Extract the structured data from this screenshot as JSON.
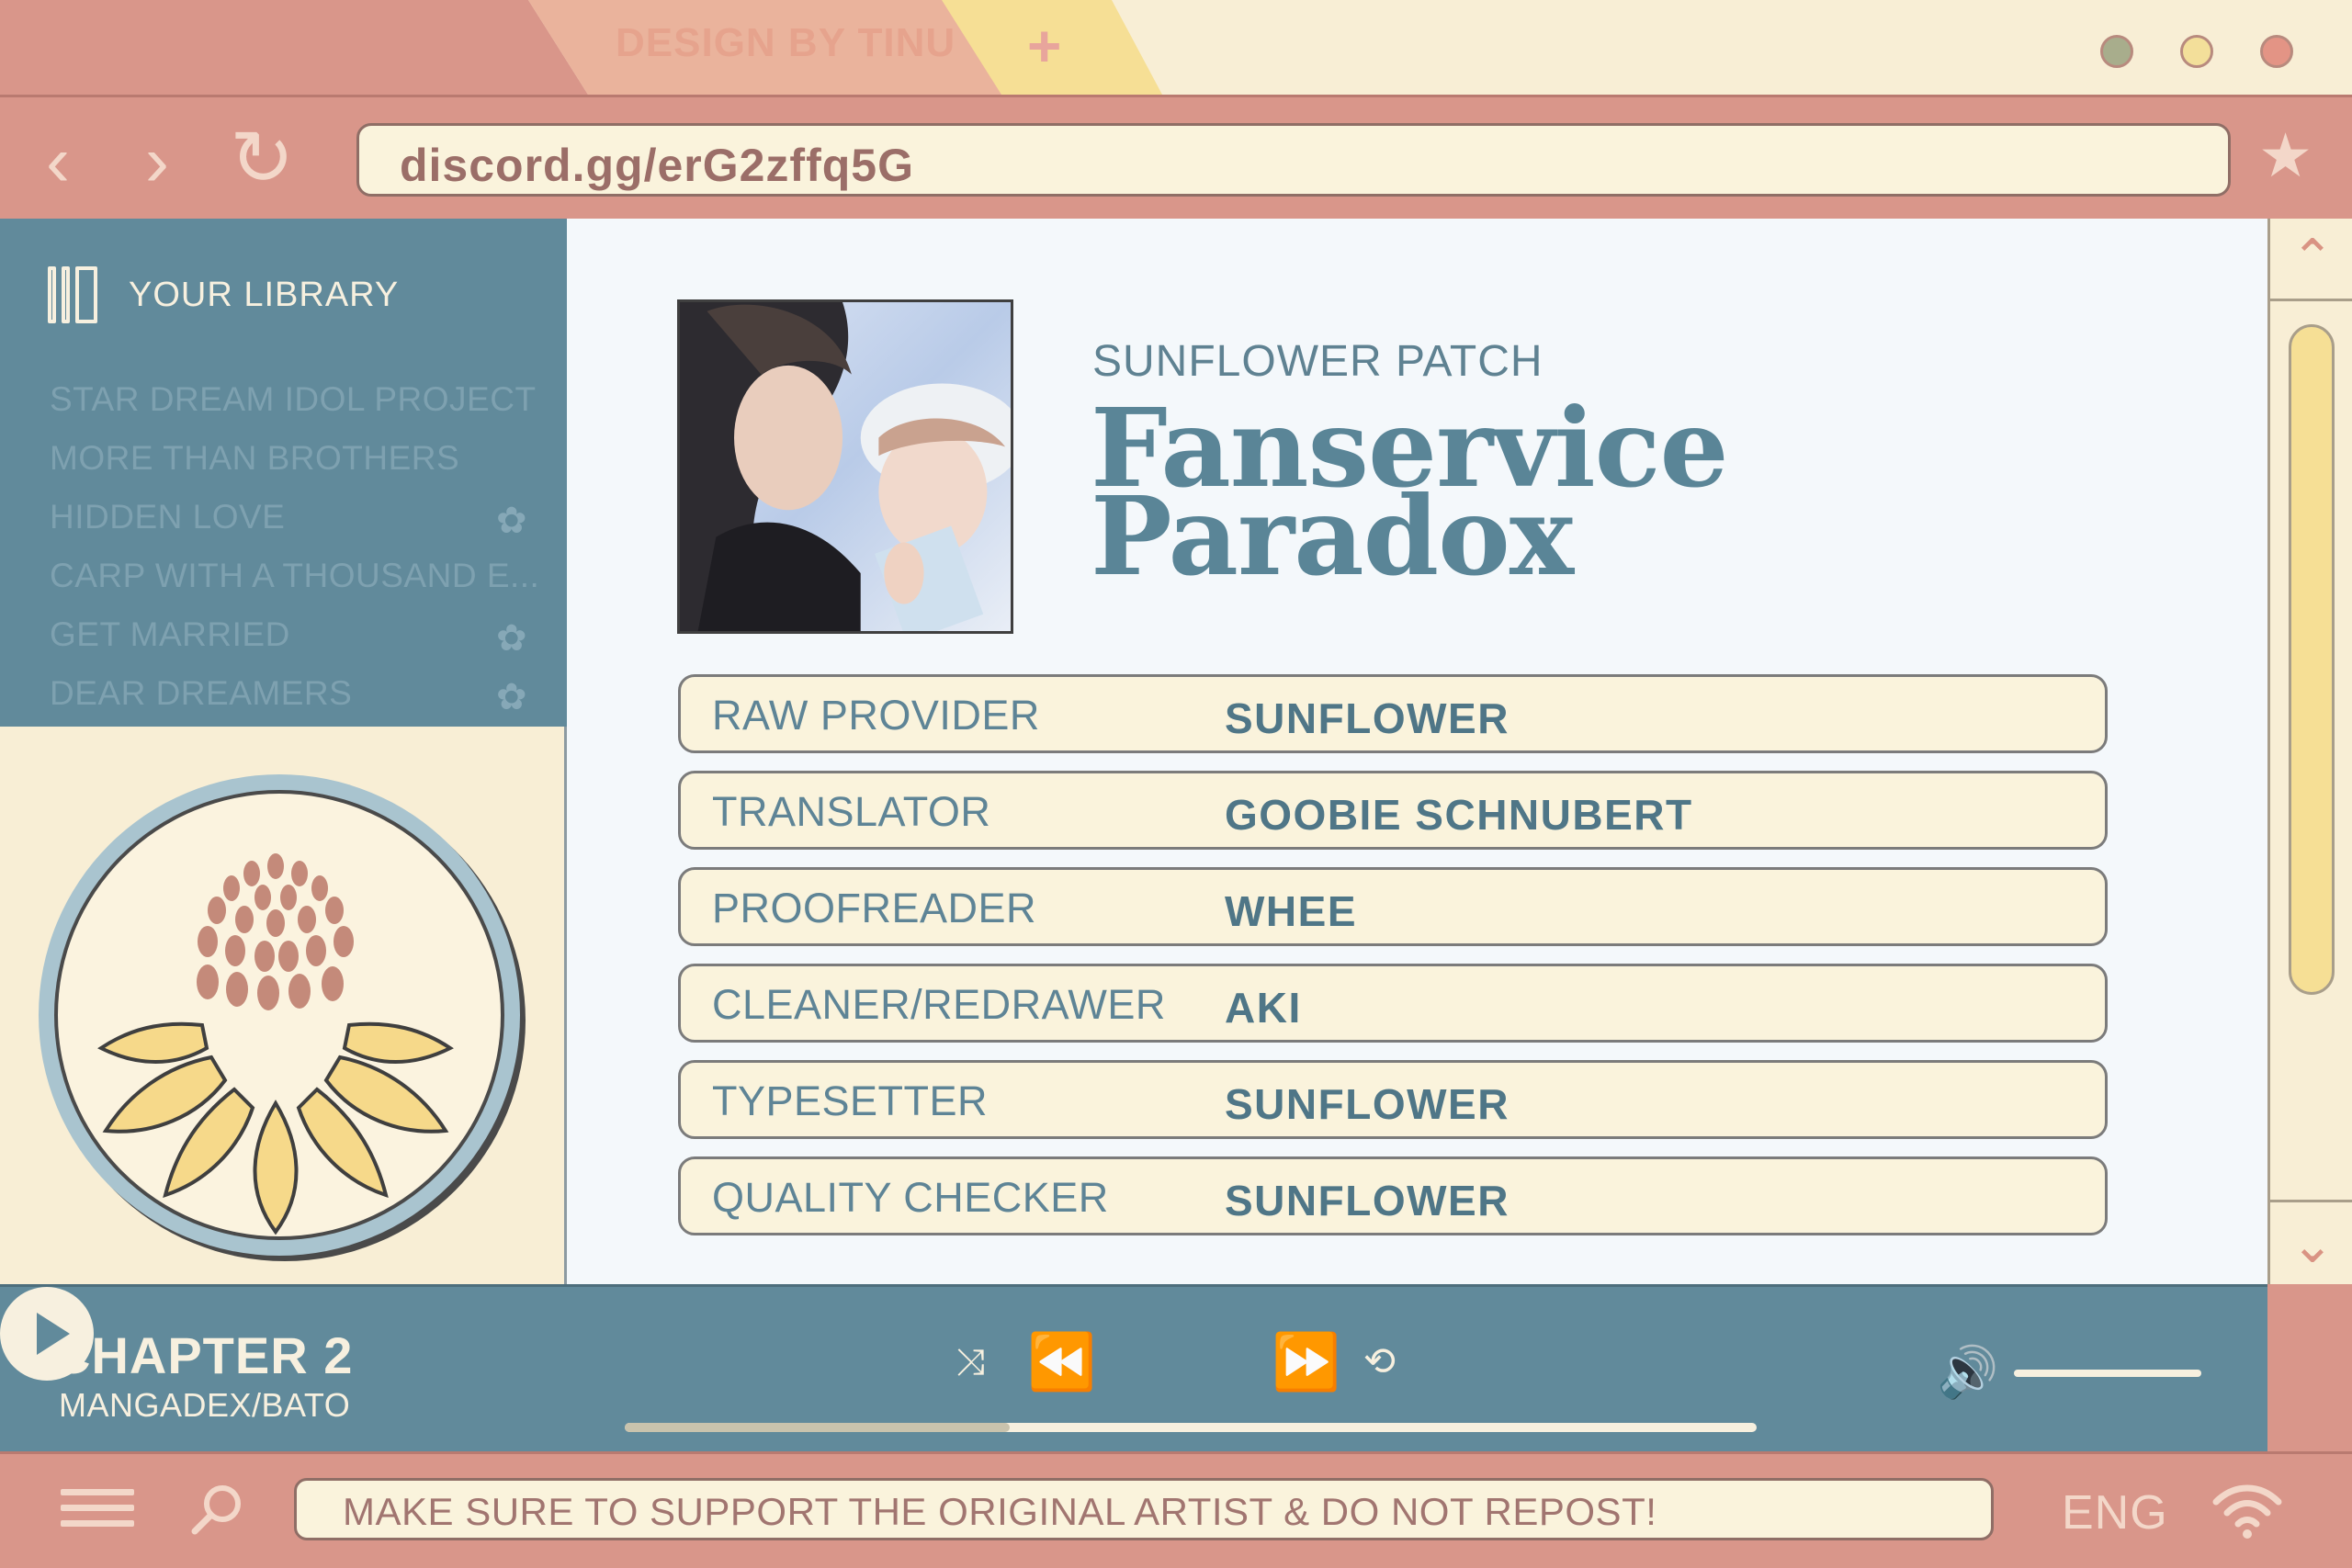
{
  "tabs": {
    "active_label": "DESIGN BY TINU",
    "new_tab_label": "+"
  },
  "window_controls": {
    "colors": {
      "minimize": "#a8ad8c",
      "maximize": "#f3df9a",
      "close": "#e39485"
    }
  },
  "address_bar": {
    "back_icon": "‹",
    "forward_icon": "›",
    "reload_icon": "↻",
    "url": "discord.gg/erG2zffq5G",
    "bookmark_icon": "★"
  },
  "sidebar": {
    "title": "YOUR LIBRARY",
    "items": [
      {
        "label": "STAR DREAM IDOL PROJECT",
        "flower": ""
      },
      {
        "label": "MORE THAN BROTHERS",
        "flower": ""
      },
      {
        "label": "HIDDEN LOVE",
        "flower": "✿"
      },
      {
        "label": "CARP WITH A THOUSAND E...",
        "flower": ""
      },
      {
        "label": "GET MARRIED",
        "flower": "✿"
      },
      {
        "label": "DEAR DREAMERS",
        "flower": "✿"
      }
    ]
  },
  "series": {
    "group": "SUNFLOWER PATCH",
    "title_line1": "Fanservice",
    "title_line2": "Paradox"
  },
  "credits": [
    {
      "role": "RAW PROVIDER",
      "name": "SUNFLOWER"
    },
    {
      "role": "TRANSLATOR",
      "name": "GOOBIE SCHNUBERT"
    },
    {
      "role": "PROOFREADER",
      "name": "WHEE"
    },
    {
      "role": "CLEANER/REDRAWER",
      "name": "AKI"
    },
    {
      "role": "TYPESETTER",
      "name": "SUNFLOWER"
    },
    {
      "role": "QUALITY CHECKER",
      "name": "SUNFLOWER"
    }
  ],
  "scrollbar": {
    "up_icon": "⌃",
    "down_icon": "⌄"
  },
  "player": {
    "chapter": "CHAPTER 2",
    "source": "MANGADEX/BATO",
    "shuffle_icon": "⤨",
    "rewind_icon": "⏪",
    "ffwd_icon": "⏩",
    "repeat_icon": "⟲",
    "volume_icon": "🔊",
    "progress_fraction": 0.34
  },
  "status_bar": {
    "notice": "MAKE SURE TO SUPPORT THE ORIGINAL ARTIST & DO NOT REPOST!",
    "language": "ENG"
  }
}
